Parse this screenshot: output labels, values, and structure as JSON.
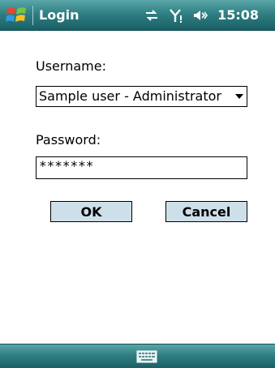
{
  "titlebar": {
    "title": "Login",
    "time": "15:08",
    "icons": [
      "windows-start-icon",
      "connectivity-icon",
      "signal-icon",
      "volume-icon"
    ]
  },
  "form": {
    "username_label": "Username:",
    "username_value": "Sample user - Administrator",
    "password_label": "Password:",
    "password_value": "*******"
  },
  "buttons": {
    "ok_label": "OK",
    "cancel_label": "Cancel"
  },
  "menubar": {
    "icons": [
      "keyboard-icon"
    ]
  },
  "colors": {
    "bar_top": "#5aa6a8",
    "bar_bottom": "#1a5f66",
    "button_fill": "#cde0ea"
  }
}
